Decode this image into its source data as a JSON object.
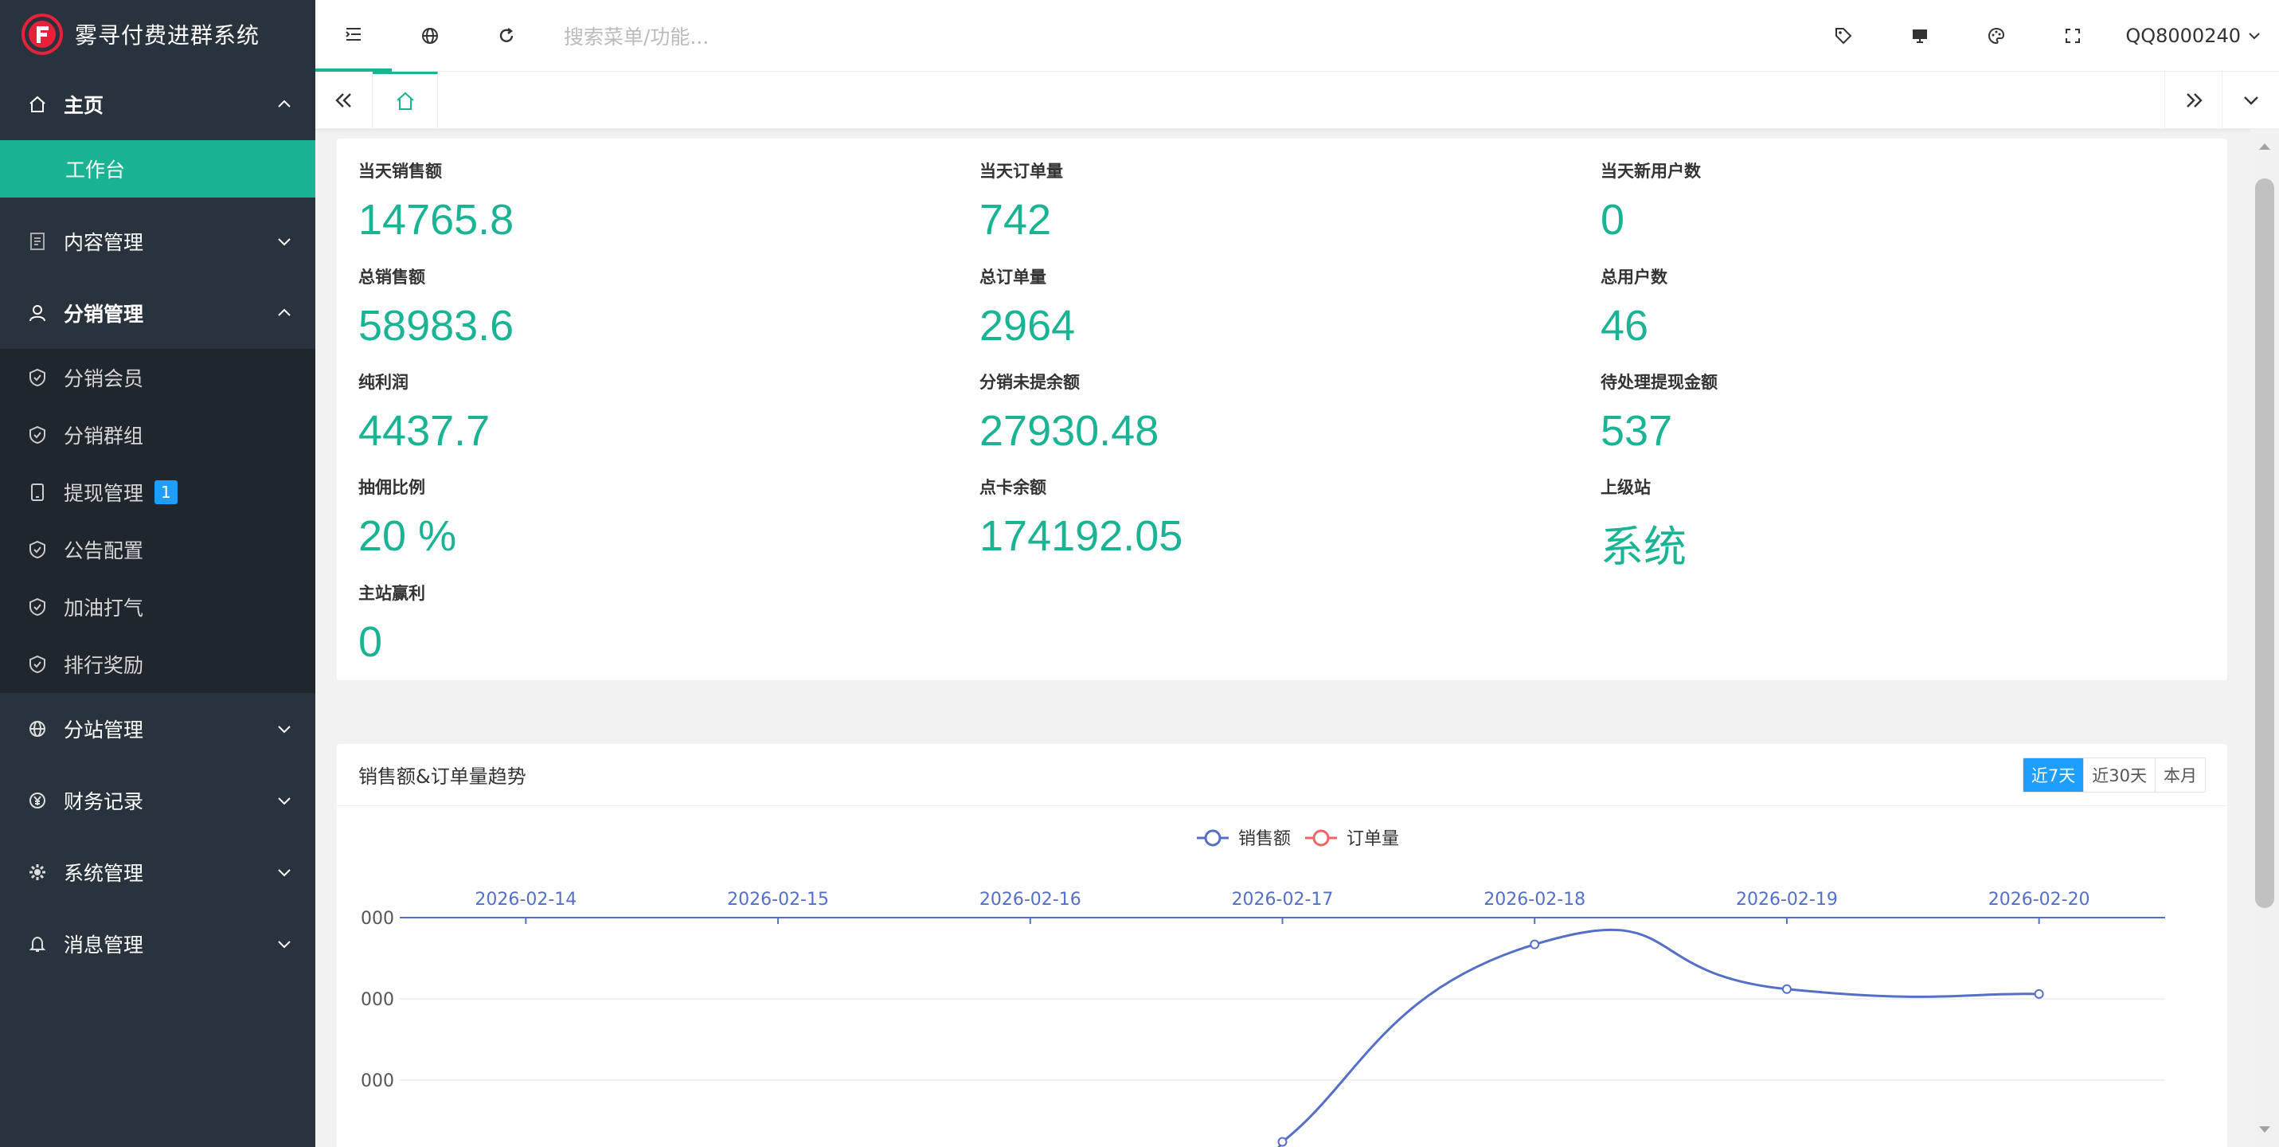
{
  "app": {
    "title": "雾寻付费进群系统"
  },
  "sidebar": {
    "groups": [
      {
        "label": "主页",
        "icon": "home-icon",
        "expanded": true,
        "items": [
          {
            "label": "工作台",
            "active": true
          }
        ]
      },
      {
        "label": "内容管理",
        "icon": "document-icon",
        "expanded": false
      },
      {
        "label": "分销管理",
        "icon": "user-icon",
        "expanded": true,
        "items": [
          {
            "label": "分销会员",
            "icon": "shield-check-icon"
          },
          {
            "label": "分销群组",
            "icon": "shield-check-icon"
          },
          {
            "label": "提现管理",
            "icon": "tablet-icon",
            "badge": "1"
          },
          {
            "label": "公告配置",
            "icon": "shield-check-icon"
          },
          {
            "label": "加油打气",
            "icon": "shield-check-icon"
          },
          {
            "label": "排行奖励",
            "icon": "shield-check-icon"
          }
        ]
      },
      {
        "label": "分站管理",
        "icon": "globe-icon",
        "expanded": false
      },
      {
        "label": "财务记录",
        "icon": "yen-icon",
        "expanded": false
      },
      {
        "label": "系统管理",
        "icon": "gear-icon",
        "expanded": false
      },
      {
        "label": "消息管理",
        "icon": "bell-icon",
        "expanded": false
      }
    ]
  },
  "header": {
    "search_placeholder": "搜索菜单/功能...",
    "user": "QQ8000240"
  },
  "stats": [
    {
      "label": "当天销售额",
      "value": "14765.8"
    },
    {
      "label": "当天订单量",
      "value": "742"
    },
    {
      "label": "当天新用户数",
      "value": "0"
    },
    {
      "label": "总销售额",
      "value": "58983.6"
    },
    {
      "label": "总订单量",
      "value": "2964"
    },
    {
      "label": "总用户数",
      "value": "46"
    },
    {
      "label": "纯利润",
      "value": "4437.7"
    },
    {
      "label": "分销未提余额",
      "value": "27930.48"
    },
    {
      "label": "待处理提现金额",
      "value": "537"
    },
    {
      "label": "抽佣比例",
      "value": "20 %"
    },
    {
      "label": "点卡余额",
      "value": "174192.05"
    },
    {
      "label": "上级站",
      "value": "系统"
    },
    {
      "label": "主站赢利",
      "value": "0"
    }
  ],
  "chart_card": {
    "title": "销售额&订单量趋势",
    "ranges": [
      "近7天",
      "近30天",
      "本月"
    ],
    "active_range": "近7天"
  },
  "chart_data": {
    "type": "line",
    "categories": [
      "2026-02-14",
      "2026-02-15",
      "2026-02-16",
      "2026-02-17",
      "2026-02-18",
      "2026-02-19",
      "2026-02-20"
    ],
    "series": [
      {
        "name": "销售额",
        "color": "#5470c6",
        "values": [
          null,
          null,
          null,
          2700,
          14850,
          12100,
          11800
        ]
      },
      {
        "name": "订单量",
        "color": "#ee6666",
        "values": []
      }
    ],
    "y_tick_labels": [
      "000",
      "000",
      "000"
    ],
    "legend": "top-center",
    "grid": true
  },
  "colors": {
    "accent": "#1ab394",
    "sidebar": "#28333e",
    "badge": "#1e9fff"
  }
}
